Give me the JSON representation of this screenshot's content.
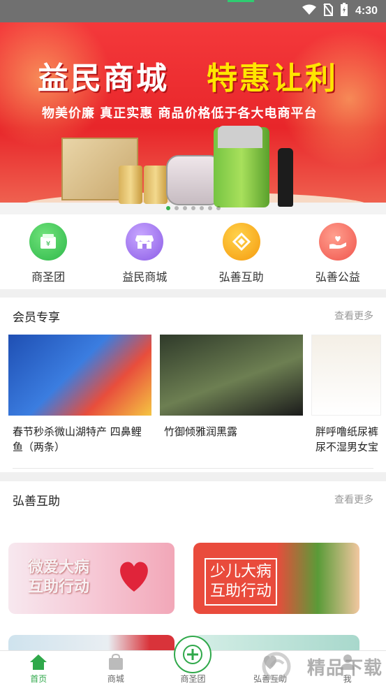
{
  "status_bar": {
    "time": "4:30",
    "icons": [
      "wifi-icon",
      "no-sim-icon",
      "battery-icon"
    ]
  },
  "banner": {
    "title_left": "益民商城",
    "title_right": "特惠让利",
    "subtitle": "物美价廉  真正实惠  商品价格低于各大电商平台",
    "slide_count": 7,
    "active_slide": 1
  },
  "nav_grid": [
    {
      "label": "商圣团",
      "icon": "wallet-icon",
      "color": "#2fb84a"
    },
    {
      "label": "益民商城",
      "icon": "shop-icon",
      "color": "#8b5ce6"
    },
    {
      "label": "弘善互助",
      "icon": "diamond-icon",
      "color": "#f59a0e"
    },
    {
      "label": "弘善公益",
      "icon": "heart-hand-icon",
      "color": "#f0544c"
    }
  ],
  "member_section": {
    "title": "会员专享",
    "more": "查看更多",
    "items": [
      {
        "name": "春节秒杀微山湖特产 四鼻鲤鱼（两条）"
      },
      {
        "name": "竹御倾雅润黑露"
      },
      {
        "name": "胖呼噜纸尿裤尿不湿男女宝"
      }
    ]
  },
  "mutual_section": {
    "title": "弘善互助",
    "more": "查看更多",
    "cards": [
      {
        "line1": "微爱大病",
        "line2": "互助行动"
      },
      {
        "line1": "少儿大病",
        "line2": "互助行动"
      }
    ]
  },
  "tabbar": [
    {
      "label": "首页",
      "active": true
    },
    {
      "label": "商城",
      "active": false
    },
    {
      "label": "商圣团",
      "active": false
    },
    {
      "label": "弘善互助",
      "active": false
    },
    {
      "label": "我",
      "active": false
    }
  ],
  "watermark": "精品下载",
  "colors": {
    "accent": "#2fa84a",
    "banner_red": "#e8262a",
    "banner_yellow": "#ffe600"
  }
}
